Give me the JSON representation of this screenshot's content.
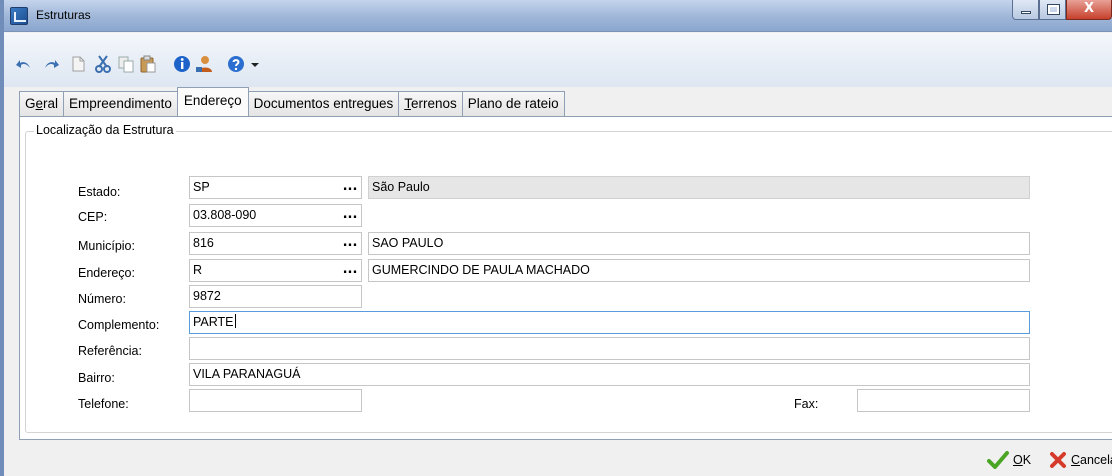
{
  "window": {
    "title": "Estruturas",
    "buttons": [
      "minimize",
      "maximize",
      "close"
    ],
    "close_glyph": "X"
  },
  "toolbar": {
    "items": [
      "undo-icon",
      "redo-icon",
      "new-document-icon",
      "cut-icon",
      "copy-icon",
      "paste-icon",
      "info-icon",
      "user-icon",
      "help-icon",
      "dropdown-arrow-icon"
    ]
  },
  "tabs": [
    {
      "label_pre": "G",
      "label_u": "e",
      "label_post": "ral",
      "active": false
    },
    {
      "label_pre": "",
      "label_u": "",
      "label_post": "Empreendimento",
      "active": false
    },
    {
      "label_pre": "",
      "label_u": "",
      "label_post": "Endereço",
      "active": true
    },
    {
      "label_pre": "",
      "label_u": "",
      "label_post": "Documentos entregues",
      "active": false
    },
    {
      "label_pre": "",
      "label_u": "T",
      "label_post": "errenos",
      "active": false
    },
    {
      "label_pre": "",
      "label_u": "",
      "label_post": "Plano de rateio",
      "active": false
    }
  ],
  "group": {
    "title": "Localização da Estrutura"
  },
  "form": {
    "estado": {
      "label": "Estado:",
      "code": "SP",
      "name": "São Paulo"
    },
    "cep": {
      "label": "CEP:",
      "value": "03.808-090"
    },
    "municipio": {
      "label": "Município:",
      "code": "816",
      "name": "SAO PAULO"
    },
    "endereco": {
      "label": "Endereço:",
      "code": "R",
      "name": "GUMERCINDO DE PAULA MACHADO"
    },
    "numero": {
      "label": "Número:",
      "value": "9872"
    },
    "complemento": {
      "label": "Complemento:",
      "value": "PARTE"
    },
    "referencia": {
      "label": "Referência:",
      "value": ""
    },
    "bairro": {
      "label": "Bairro:",
      "value": "VILA PARANAGUÁ"
    },
    "telefone": {
      "label": "Telefone:",
      "value": ""
    },
    "fax": {
      "label": "Fax:",
      "value": ""
    },
    "ellipsis": "..."
  },
  "footer": {
    "ok_u": "O",
    "ok_rest": "K",
    "cancel_u": "C",
    "cancel_rest": "ancela"
  },
  "colors": {
    "accent_focus": "#5a9be0",
    "ok_green": "#4aa524",
    "cancel_red": "#d63a2a"
  }
}
